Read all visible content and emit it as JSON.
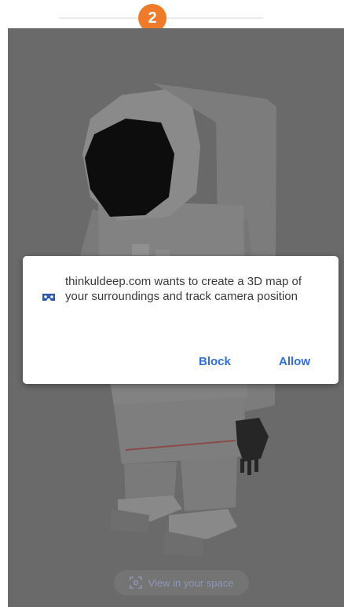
{
  "step": {
    "number": "2",
    "color": "#ee7a2a"
  },
  "permission_dialog": {
    "icon": "vr-headset-icon",
    "message": "thinkuldeep.com wants to create a 3D map of your surroundings and track camera position",
    "block_label": "Block",
    "allow_label": "Allow",
    "button_color": "#2f6fd6"
  },
  "ar_button": {
    "icon": "ar-view-icon",
    "label": "View in your space"
  }
}
